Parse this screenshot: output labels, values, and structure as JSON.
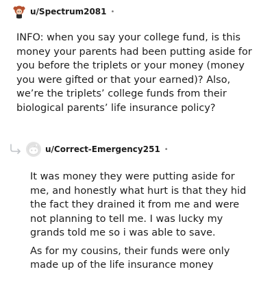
{
  "top_comment": {
    "username": "u/Spectrum2081",
    "separator": "•",
    "body": "INFO: when you say your college fund, is this money your parents had been putting aside for you before the triplets or your money (money you were gifted or that your earned)? Also, we’re the triplets’ college funds from their biological parents’ life insurance policy?"
  },
  "reply": {
    "username": "u/Correct-Emergency251",
    "separator": "•",
    "paragraphs": [
      "It was money they were putting aside for me, and honestly what hurt is that they hid the fact they drained it from me and were not planning to tell me. I was lucky my grands told me so i was able to save.",
      "As for my cousins, their funds were only made up of the life insurance money"
    ]
  }
}
